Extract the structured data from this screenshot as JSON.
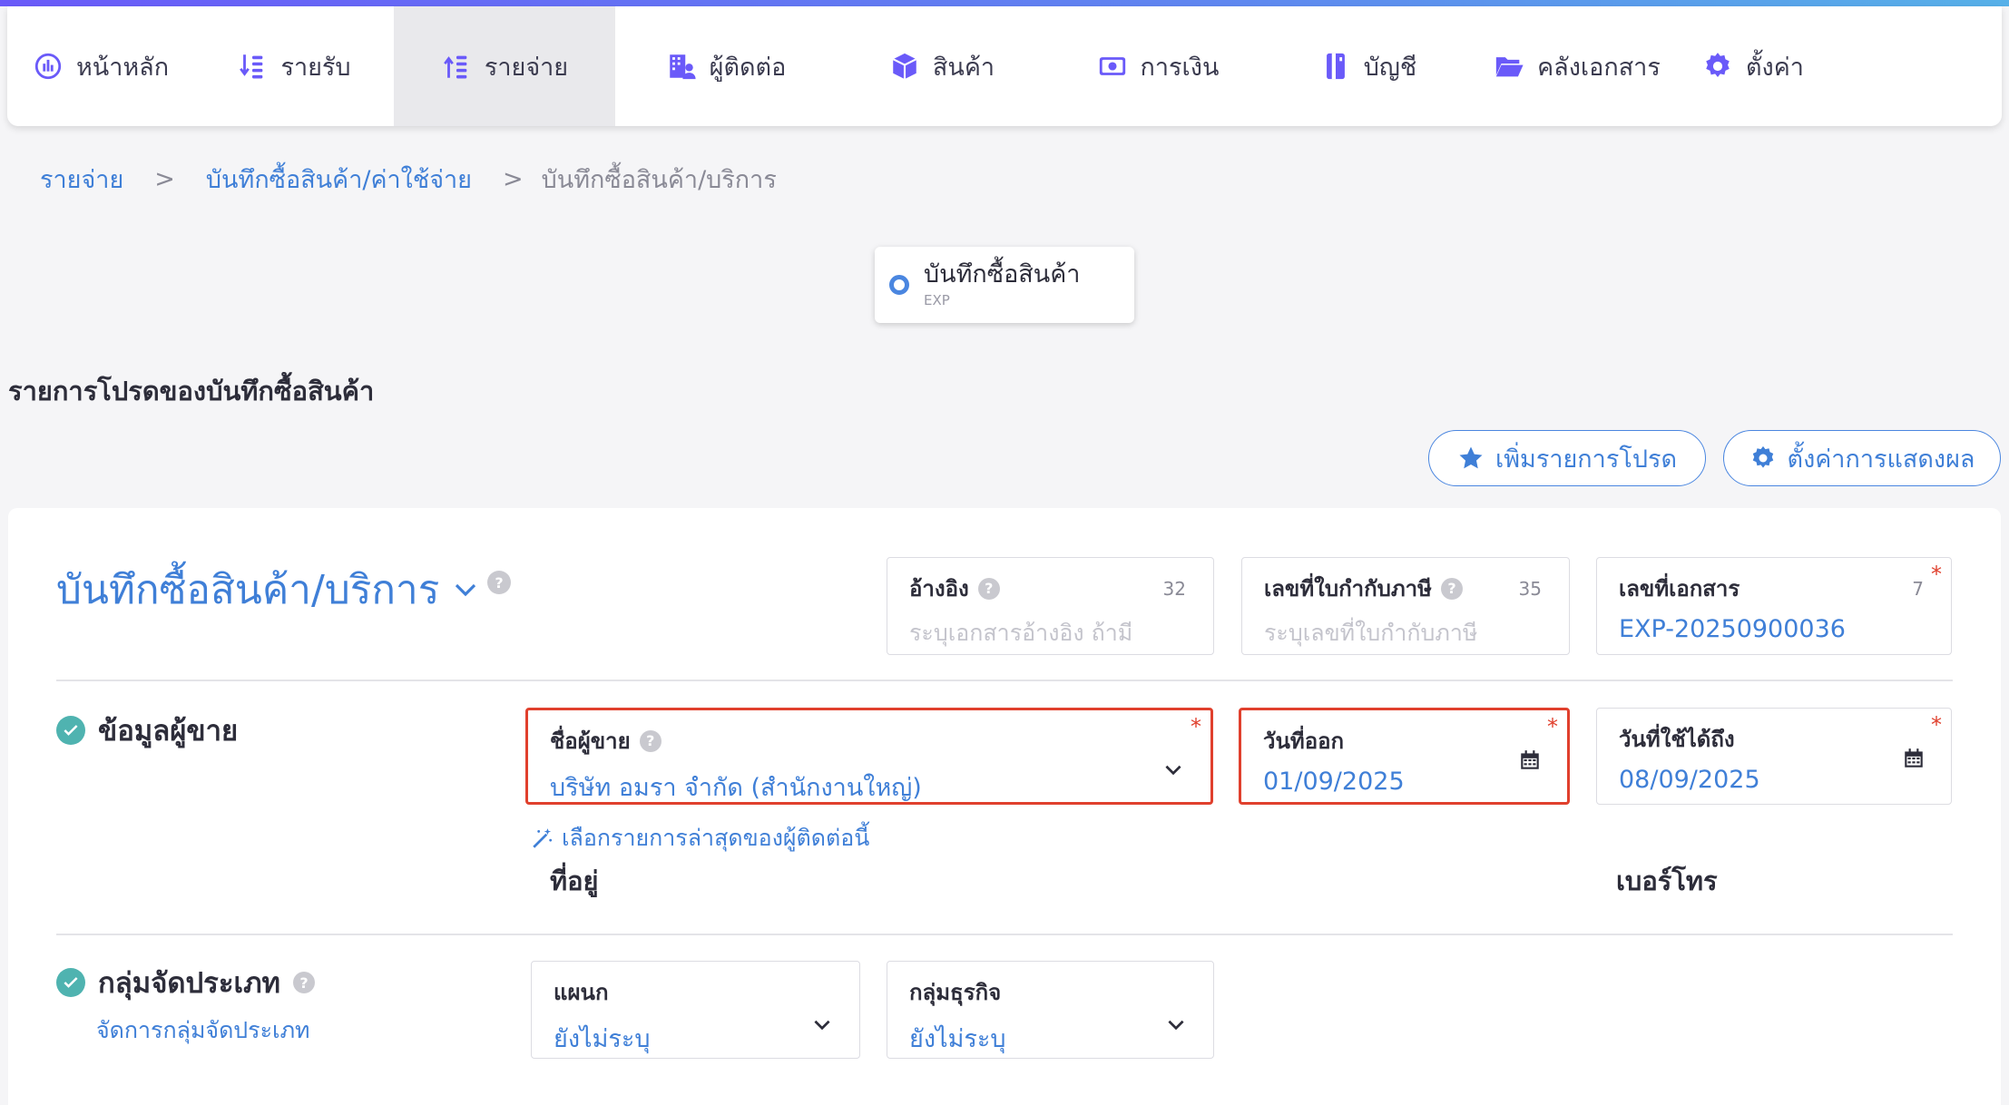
{
  "nav": {
    "items": [
      {
        "label": "หน้าหลัก",
        "icon": "dashboard-icon",
        "active": false
      },
      {
        "label": "รายรับ",
        "icon": "income-sort-icon",
        "active": false
      },
      {
        "label": "รายจ่าย",
        "icon": "expense-sort-icon",
        "active": true
      },
      {
        "label": "ผู้ติดต่อ",
        "icon": "building-contacts-icon",
        "active": false
      },
      {
        "label": "สินค้า",
        "icon": "box-icon",
        "active": false
      },
      {
        "label": "การเงิน",
        "icon": "money-icon",
        "active": false
      },
      {
        "label": "บัญชี",
        "icon": "ledger-book-icon",
        "active": false
      },
      {
        "label": "คลังเอกสาร",
        "icon": "folder-open-icon",
        "active": false
      },
      {
        "label": "ตั้งค่า",
        "icon": "gear-icon",
        "active": false
      }
    ]
  },
  "breadcrumb": {
    "items": [
      "รายจ่าย",
      "บันทึกซื้อสินค้า/ค่าใช้จ่าย",
      "บันทึกซื้อสินค้า/บริการ"
    ],
    "separator": ">"
  },
  "doctype": {
    "title": "บันทึกซื้อสินค้า",
    "code": "EXP"
  },
  "favorites": {
    "heading": "รายการโปรดของบันทึกซื้อสินค้า",
    "add_button": "เพิ่มรายการโปรด",
    "display_settings_button": "ตั้งค่าการแสดงผล"
  },
  "document": {
    "title": "บันทึกซื้อสินค้า/บริการ",
    "reference": {
      "label": "อ้างอิง",
      "counter": "32",
      "placeholder": "ระบุเอกสารอ้างอิง ถ้ามี"
    },
    "tax_invoice": {
      "label": "เลขที่ใบกำกับภาษี",
      "counter": "35",
      "placeholder": "ระบุเลขที่ใบกำกับภาษี"
    },
    "doc_number": {
      "label": "เลขที่เอกสาร",
      "counter": "7",
      "value": "EXP-20250900036",
      "required_mark": "*"
    }
  },
  "vendor_section": {
    "title": "ข้อมูลผู้ขาย",
    "vendor": {
      "label": "ชื่อผู้ขาย",
      "value": "บริษัท อมรา จำกัด (สำนักงานใหญ่)",
      "required_mark": "*"
    },
    "issue_date": {
      "label": "วันที่ออก",
      "value": "01/09/2025",
      "required_mark": "*"
    },
    "valid_until": {
      "label": "วันที่ใช้ได้ถึง",
      "value": "08/09/2025",
      "required_mark": "*"
    },
    "recent_link": "เลือกรายการล่าสุดของผู้ติดต่อนี้",
    "address_label": "ที่อยู่",
    "phone_label": "เบอร์โทร"
  },
  "category_section": {
    "title": "กลุ่มจัดประเภท",
    "manage_link": "จัดการกลุ่มจัดประเภท",
    "department": {
      "label": "แผนก",
      "value": "ยังไม่ระบุ"
    },
    "business_group": {
      "label": "กลุ่มธุรกิจ",
      "value": "ยังไม่ระบุ"
    }
  },
  "colors": {
    "accent": "#3f7fd7",
    "highlight": "#e0402d",
    "check": "#4fb3b0"
  }
}
